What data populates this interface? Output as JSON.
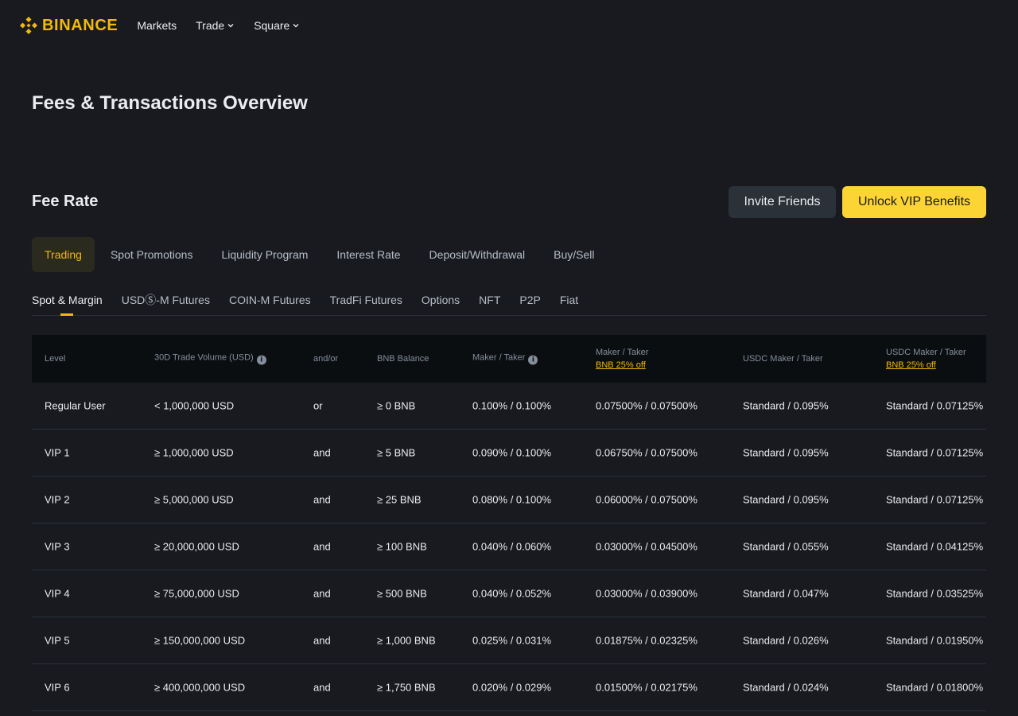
{
  "header": {
    "brand": "BINANCE",
    "brand_color": "#f0b90b",
    "nav": [
      {
        "label": "Markets",
        "dropdown": false
      },
      {
        "label": "Trade",
        "dropdown": true
      },
      {
        "label": "Square",
        "dropdown": true
      }
    ]
  },
  "page_title": "Fees & Transactions Overview",
  "fee_section": {
    "title": "Fee Rate",
    "invite_label": "Invite Friends",
    "vip_label": "Unlock VIP Benefits"
  },
  "main_tabs": [
    {
      "label": "Trading",
      "active": true
    },
    {
      "label": "Spot Promotions",
      "active": false
    },
    {
      "label": "Liquidity Program",
      "active": false
    },
    {
      "label": "Interest Rate",
      "active": false
    },
    {
      "label": "Deposit/Withdrawal",
      "active": false
    },
    {
      "label": "Buy/Sell",
      "active": false
    }
  ],
  "sub_tabs": [
    {
      "label": "Spot & Margin",
      "active": true
    },
    {
      "label": "USDⓈ-M Futures",
      "active": false
    },
    {
      "label": "COIN-M Futures",
      "active": false
    },
    {
      "label": "TradFi Futures",
      "active": false
    },
    {
      "label": "Options",
      "active": false
    },
    {
      "label": "NFT",
      "active": false
    },
    {
      "label": "P2P",
      "active": false
    },
    {
      "label": "Fiat",
      "active": false
    }
  ],
  "table": {
    "headers": {
      "level": "Level",
      "volume": "30D Trade Volume (USD)",
      "andor": "and/or",
      "bnb": "BNB Balance",
      "maker_taker": "Maker / Taker",
      "maker_taker_bnb": "Maker / Taker",
      "maker_taker_bnb_sub": "BNB 25% off",
      "usdc": "USDC Maker / Taker",
      "usdc_bnb": "USDC Maker / Taker",
      "usdc_bnb_sub": "BNB 25% off"
    },
    "rows": [
      [
        "Regular User",
        "< 1,000,000 USD",
        "or",
        "≥ 0 BNB",
        "0.100% / 0.100%",
        "0.07500% / 0.07500%",
        "Standard / 0.095%",
        "Standard / 0.07125%"
      ],
      [
        "VIP 1",
        "≥ 1,000,000 USD",
        "and",
        "≥ 5 BNB",
        "0.090% / 0.100%",
        "0.06750% / 0.07500%",
        "Standard / 0.095%",
        "Standard / 0.07125%"
      ],
      [
        "VIP 2",
        "≥ 5,000,000 USD",
        "and",
        "≥ 25 BNB",
        "0.080% / 0.100%",
        "0.06000% / 0.07500%",
        "Standard / 0.095%",
        "Standard / 0.07125%"
      ],
      [
        "VIP 3",
        "≥ 20,000,000 USD",
        "and",
        "≥ 100 BNB",
        "0.040% / 0.060%",
        "0.03000% / 0.04500%",
        "Standard / 0.055%",
        "Standard / 0.04125%"
      ],
      [
        "VIP 4",
        "≥ 75,000,000 USD",
        "and",
        "≥ 500 BNB",
        "0.040% / 0.052%",
        "0.03000% / 0.03900%",
        "Standard / 0.047%",
        "Standard / 0.03525%"
      ],
      [
        "VIP 5",
        "≥ 150,000,000 USD",
        "and",
        "≥ 1,000 BNB",
        "0.025% / 0.031%",
        "0.01875% / 0.02325%",
        "Standard / 0.026%",
        "Standard / 0.01950%"
      ],
      [
        "VIP 6",
        "≥ 400,000,000 USD",
        "and",
        "≥ 1,750 BNB",
        "0.020% / 0.029%",
        "0.01500% / 0.02175%",
        "Standard / 0.024%",
        "Standard / 0.01800%"
      ]
    ]
  }
}
